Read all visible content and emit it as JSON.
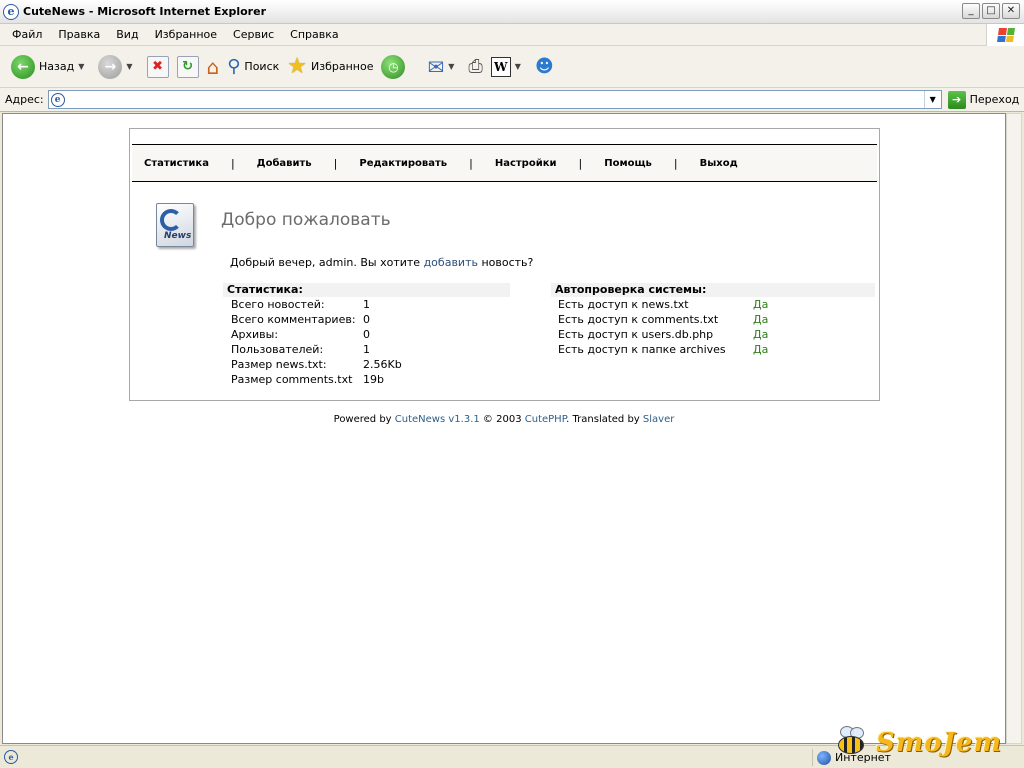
{
  "window": {
    "title": "CuteNews - Microsoft Internet Explorer",
    "buttons": {
      "minimize": "_",
      "maximize": "□",
      "close": "✕"
    }
  },
  "menu": [
    "Файл",
    "Правка",
    "Вид",
    "Избранное",
    "Сервис",
    "Справка"
  ],
  "toolbar": {
    "back_label": "Назад",
    "search_label": "Поиск",
    "favorites_label": "Избранное"
  },
  "address": {
    "label": "Адрес:",
    "value": "",
    "go_label": "Переход"
  },
  "cutenews": {
    "nav": [
      "Статистика",
      "Добавить",
      "Редактировать",
      "Настройки",
      "Помощь",
      "Выход"
    ],
    "nav_separator": "|",
    "logo_text": "News",
    "welcome_title": "Добро пожаловать",
    "greeting_prefix": "Добрый вечер, admin. Вы хотите ",
    "greeting_link": "добавить",
    "greeting_suffix": " новость?",
    "stats_title": "Статистика:",
    "stats": [
      {
        "key": "Всего новостей:",
        "value": "1"
      },
      {
        "key": "Всего комментариев:",
        "value": "0"
      },
      {
        "key": "Архивы:",
        "value": "0"
      },
      {
        "key": "Пользователей:",
        "value": "1"
      },
      {
        "key": "Размер news.txt:",
        "value": "2.56Kb"
      },
      {
        "key": "Размер comments.txt",
        "value": "19b"
      }
    ],
    "check_title": "Автопроверка системы:",
    "checks": [
      {
        "key": "Есть доступ к news.txt",
        "value": "Да"
      },
      {
        "key": "Есть доступ к comments.txt",
        "value": "Да"
      },
      {
        "key": "Есть доступ к users.db.php",
        "value": "Да"
      },
      {
        "key": "Есть доступ к папке archives",
        "value": "Да"
      }
    ],
    "footer": {
      "powered_by": "Powered by ",
      "cutenews_link": "CuteNews v1.3.1",
      "copyright": " © 2003 ",
      "cutephp_link": "CutePHP",
      "translated": ". Translated by ",
      "slaver_link": "Slaver"
    }
  },
  "statusbar": {
    "zone": "Интернет"
  },
  "watermark": {
    "text": "SmoJem"
  },
  "colors": {
    "link": "#2c4f7a",
    "ok": "#2f7d1c",
    "watermark": "#f5b81c"
  }
}
